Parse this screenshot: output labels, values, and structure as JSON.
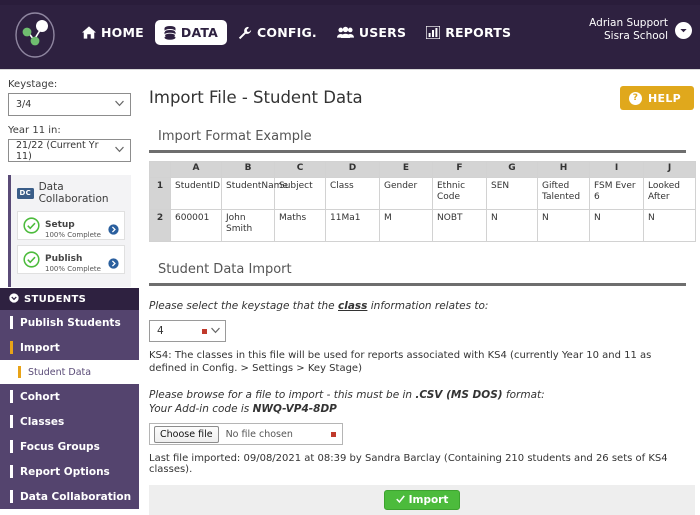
{
  "header": {
    "brand_icon": "network-nodes-logo",
    "nav": [
      {
        "label": "HOME",
        "icon": "home-icon",
        "active": false
      },
      {
        "label": "DATA",
        "icon": "database-icon",
        "active": true
      },
      {
        "label": "CONFIG.",
        "icon": "wrench-icon",
        "active": false
      },
      {
        "label": "USERS",
        "icon": "users-icon",
        "active": false
      },
      {
        "label": "REPORTS",
        "icon": "bar-chart-icon",
        "active": false
      }
    ],
    "user": {
      "name": "Adrian Support",
      "school": "Sisra School",
      "caret_icon": "chevron-down-icon"
    }
  },
  "sidebar": {
    "keystage": {
      "label": "Keystage:",
      "value": "3/4"
    },
    "year": {
      "label": "Year 11 in:",
      "value": "21/22 (Current Yr 11)"
    },
    "data_collaboration": {
      "badge": "DC",
      "title": "Data Collaboration",
      "cards": [
        {
          "title": "Setup",
          "subtitle": "100% Complete",
          "status_icon": "check-circle-icon",
          "arrow_icon": "chevron-right-circle-icon"
        },
        {
          "title": "Publish",
          "subtitle": "100% Complete",
          "status_icon": "check-circle-icon",
          "arrow_icon": "chevron-right-circle-icon"
        }
      ]
    },
    "students": {
      "header": "STUDENTS",
      "header_icon": "chevron-down-circle-icon",
      "items": [
        {
          "label": "Publish Students",
          "accent": "white",
          "active": false,
          "sub": false
        },
        {
          "label": "Import",
          "accent": "gold",
          "active": true,
          "sub": false
        },
        {
          "label": "Student Data",
          "accent": "gold",
          "active": true,
          "sub": true
        },
        {
          "label": "Cohort",
          "accent": "white",
          "active": false,
          "sub": false
        },
        {
          "label": "Classes",
          "accent": "white",
          "active": false,
          "sub": false
        },
        {
          "label": "Focus Groups",
          "accent": "white",
          "active": false,
          "sub": false
        },
        {
          "label": "Report Options",
          "accent": "white",
          "active": false,
          "sub": false
        },
        {
          "label": "Data Collaboration",
          "accent": "white",
          "active": false,
          "sub": false
        }
      ]
    }
  },
  "main": {
    "page_title": "Import File - Student Data",
    "help_label": "HELP",
    "help_icon": "question-mark-icon",
    "format_section_title": "Import Format Example",
    "import_section_title": "Student Data Import",
    "sheet": {
      "columns": [
        "A",
        "B",
        "C",
        "D",
        "E",
        "F",
        "G",
        "H",
        "I",
        "J"
      ],
      "rows": [
        {
          "num": "1",
          "cells": [
            "StudentID",
            "StudentName",
            "Subject",
            "Class",
            "Gender",
            "Ethnic Code",
            "SEN",
            "Gifted Talented",
            "FSM Ever 6",
            "Looked After"
          ]
        },
        {
          "num": "2",
          "cells": [
            "600001",
            "John Smith",
            "Maths",
            "11Ma1",
            "M",
            "NOBT",
            "N",
            "N",
            "N",
            "N"
          ]
        }
      ]
    },
    "keystage_prompt_pre": "Please select the keystage that the ",
    "keystage_prompt_link": "class",
    "keystage_prompt_post": " information relates to:",
    "keystage_value": "4",
    "keystage_note": "KS4: The classes in this file will be used for reports associated with KS4 (currently Year 10 and 11 as defined in Config. > Settings > Key Stage)",
    "browse_prompt_pre": "Please browse for a file to import - this must be in ",
    "browse_prompt_bold": ".CSV (MS DOS)",
    "browse_prompt_post": " format:",
    "addin_pre": "Your Add-in code is ",
    "addin_code": "NWQ-VP4-8DP",
    "choose_file_label": "Choose file",
    "no_file_text": "No file chosen",
    "last_imported": "Last file imported: 09/08/2021 at 08:39 by Sandra Barclay (Containing 210 students and 26 sets of KS4 classes).",
    "import_label": "Import",
    "import_icon": "check-icon"
  },
  "colors": {
    "header_purple": "#2e2140",
    "menu_purple": "#54446e",
    "accent_gold": "#e8a317",
    "help_gold": "#e0a81c",
    "import_green": "#4cbb3c",
    "required_red": "#c0392b"
  }
}
